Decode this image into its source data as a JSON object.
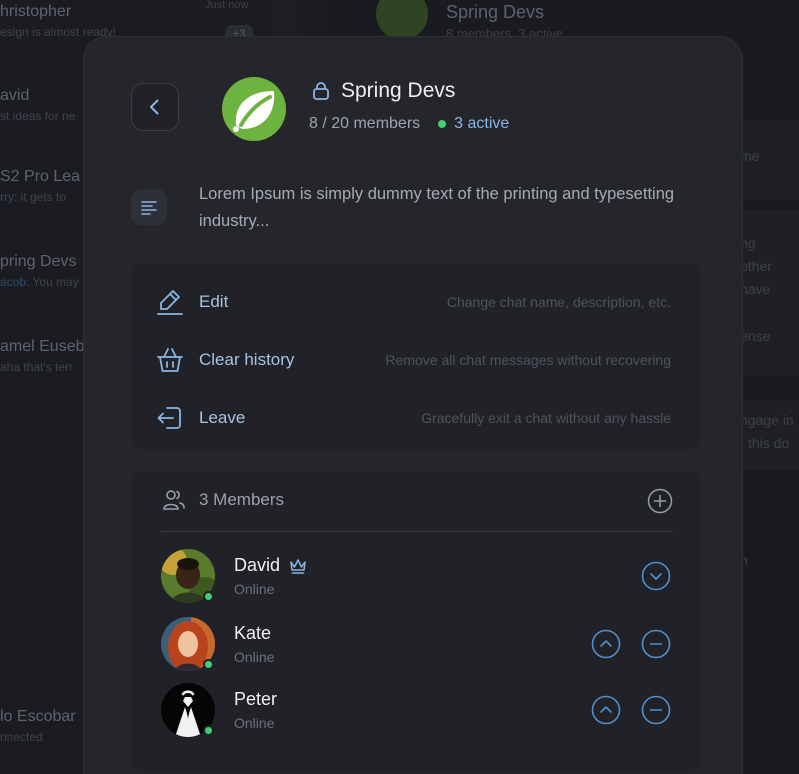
{
  "background": {
    "conversations": [
      {
        "name": "hristopher",
        "preview": "esign is almost ready!",
        "time": "Just now",
        "badge": "+3"
      },
      {
        "name": "avid",
        "preview": "st ideas for ne"
      },
      {
        "name": "S2 Pro Lea",
        "preview_accent": "rry:",
        "preview": " it gets to"
      },
      {
        "name": "pring Devs",
        "preview_accent": "acob:",
        "preview": " You may"
      },
      {
        "name": "amel Euseb",
        "preview": "aha that's terr"
      },
      {
        "name": "lo Escobar",
        "preview": "nnected"
      }
    ],
    "header": {
      "title": "Spring Devs",
      "subtitle": "8 members, 3 active"
    },
    "snippets": [
      "me",
      "ng",
      "other",
      "have",
      "ense",
      "ngage in",
      "this do",
      "n"
    ]
  },
  "modal": {
    "group": {
      "name": "Spring Devs",
      "members_text": "8 / 20 members",
      "active_text": "3 active",
      "description": "Lorem Ipsum is simply dummy text of the printing and typesetting industry..."
    },
    "actions": [
      {
        "label": "Edit",
        "hint": "Change chat name, description, etc.",
        "icon": "pencil-icon"
      },
      {
        "label": "Clear history",
        "hint": "Remove all chat messages without recovering",
        "icon": "basket-icon"
      },
      {
        "label": "Leave",
        "hint": "Gracefully exit a chat without any hassle",
        "icon": "leave-icon"
      }
    ],
    "members_section": {
      "title": "3 Members",
      "members": [
        {
          "name": "David",
          "status": "Online",
          "role_icon": "crown-icon"
        },
        {
          "name": "Kate",
          "status": "Online"
        },
        {
          "name": "Peter",
          "status": "Online"
        }
      ]
    }
  },
  "colors": {
    "accent": "#4e8fd0",
    "online": "#3fcf74",
    "spring_green": "#6db33f"
  }
}
